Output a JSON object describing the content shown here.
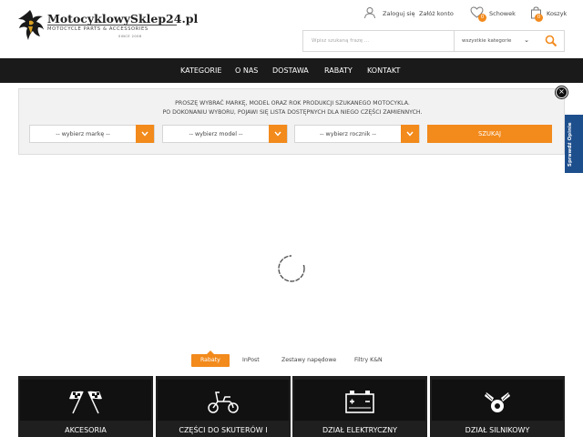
{
  "header": {
    "logo": {
      "brand": "MotocyklowySklep24.pl",
      "tagline": "MOTOCYCLE PARTS & ACCESSORIES",
      "since": "SINCE 2008"
    },
    "login_label": "Zaloguj się",
    "register_label": "Załóż konto",
    "wishlist_label": "Schowek",
    "wishlist_count": "0",
    "cart_label": "Koszyk",
    "cart_count": "0"
  },
  "search": {
    "placeholder": "Wpisz szukaną frazę ...",
    "category_value": "wszystkie kategorie"
  },
  "nav": {
    "items": [
      {
        "label": "KATEGORIE"
      },
      {
        "label": "O NAS"
      },
      {
        "label": "DOSTAWA"
      },
      {
        "label": "RABATY"
      },
      {
        "label": "KONTAKT"
      }
    ]
  },
  "filter": {
    "line1": "PROSZĘ WYBRAĆ MARKĘ, MODEL ORAZ ROK PRODUKCJI SZUKANEGO MOTOCYKLA.",
    "line2": "PO DOKONANIU WYBORU, POJAWI SIĘ LISTA DOSTĘPNYCH DLA NIEGO CZĘŚCI ZAMIENNYCH.",
    "brand_select": "-- wybierz markę --",
    "model_select": "-- wybierz model --",
    "year_select": "-- wybierz rocznik --",
    "search_label": "SZUKAJ"
  },
  "side_tab": {
    "label": "Sprawdź Opinie"
  },
  "tabs": [
    {
      "label": "Rabaty",
      "active": true
    },
    {
      "label": "InPost",
      "active": false
    },
    {
      "label": "Zestawy napędowe",
      "active": false
    },
    {
      "label": "Filtry K&N",
      "active": false
    }
  ],
  "categories": [
    {
      "label": "AKCESORIA",
      "icon": "checkered-flags-icon"
    },
    {
      "label": "CZĘŚCI DO SKUTERÓW I",
      "icon": "scooter-icon"
    },
    {
      "label": "DZIAŁ ELEKTRYCZNY",
      "icon": "battery-icon"
    },
    {
      "label": "DZIAŁ SILNIKOWY",
      "icon": "engine-icon"
    }
  ],
  "colors": {
    "accent": "#f28a1c",
    "nav_bg": "#1a1a1a",
    "card_bg": "#1f1f1f",
    "side_tab": "#1e4f8d"
  }
}
